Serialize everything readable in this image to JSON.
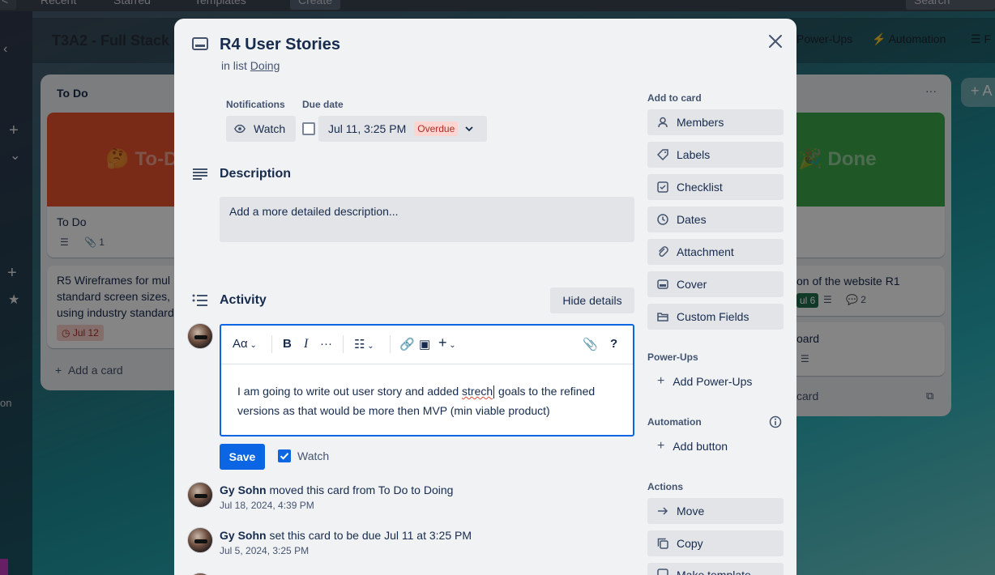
{
  "background": {
    "top_nav": [
      "Recent",
      "Starred",
      "Templates",
      "Create",
      "Search"
    ],
    "board_title": "T3A2 - Full Stack",
    "board_actions": [
      "Power-Ups",
      "Automation",
      "F"
    ],
    "lists": {
      "todo": {
        "title": "To Do",
        "cover_text": "🤔 To-D",
        "card1": "To Do",
        "card1_attach": "1",
        "card2": "R5 Wireframes for mul standard screen sizes, using industry standard",
        "card2_date": "Jul 12",
        "add_card": "Add a card"
      },
      "done": {
        "cover_text": "🎉 Done",
        "card1": "on of the website R1",
        "card1_badge": "ul 6",
        "card1_comments": "2",
        "card2": "oard",
        "add_card": "card"
      }
    },
    "left_sidebar_text": "on"
  },
  "modal": {
    "title": "R4 User Stories",
    "in_list_prefix": "in list",
    "list_name": "Doing",
    "notifications_label": "Notifications",
    "watch_label": "Watch",
    "due_date_label": "Due date",
    "due_date_value": "Jul 11, 3:25 PM",
    "overdue_badge": "Overdue",
    "description_title": "Description",
    "description_placeholder": "Add a more detailed description...",
    "activity_title": "Activity",
    "hide_details": "Hide details",
    "editor": {
      "text_style": "Aα",
      "text_before": "I am going to write out user story and added ",
      "misspelled": "strech",
      "text_after": " goals to the refined versions as that would be more then MVP (min viable product)",
      "save_label": "Save",
      "watch_label": "Watch",
      "watch_checked": true
    },
    "activity": [
      {
        "user": "Gy Sohn",
        "action": "moved this card from To Do to Doing",
        "time": "Jul 18, 2024, 4:39 PM"
      },
      {
        "user": "Gy Sohn",
        "action": "set this card to be due Jul 11 at 3:25 PM",
        "time": "Jul 5, 2024, 3:25 PM"
      }
    ],
    "sidebar": {
      "add_to_card": "Add to card",
      "add_items": [
        "Members",
        "Labels",
        "Checklist",
        "Dates",
        "Attachment",
        "Cover",
        "Custom Fields"
      ],
      "powerups_title": "Power-Ups",
      "add_powerups": "Add Power-Ups",
      "automation_title": "Automation",
      "add_button": "Add button",
      "actions_title": "Actions",
      "actions": [
        "Move",
        "Copy",
        "Make template"
      ]
    }
  },
  "colors": {
    "primary": "#0c66e4",
    "overdue_bg": "#ffd5d2",
    "overdue_text": "#ae2e24",
    "todo_cover": "#e8532f",
    "done_cover": "#3fa84a"
  }
}
